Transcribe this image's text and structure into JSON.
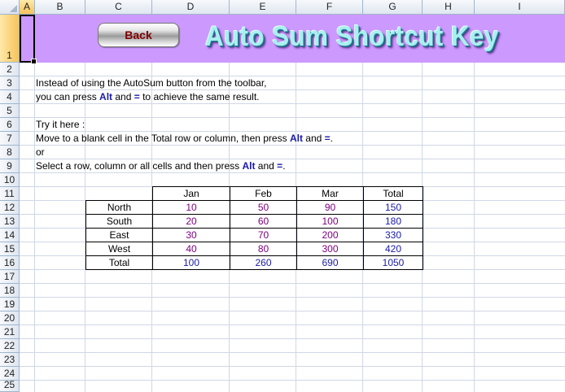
{
  "columns": [
    "A",
    "B",
    "C",
    "D",
    "E",
    "F",
    "G",
    "H",
    "I"
  ],
  "rows": [
    "1",
    "2",
    "3",
    "4",
    "5",
    "6",
    "7",
    "8",
    "9",
    "10",
    "11",
    "12",
    "13",
    "14",
    "15",
    "16",
    "17",
    "18",
    "19",
    "20",
    "21",
    "22",
    "23",
    "24",
    "25"
  ],
  "banner": {
    "back_label": "Back",
    "title": "Auto Sum Shortcut Key",
    "background": "#cc99ff"
  },
  "text": {
    "line3": "Instead of using the AutoSum button from the toolbar,",
    "line4_a": "you can press ",
    "line4_alt": "Alt",
    "line4_b": " and ",
    "line4_eq": "=",
    "line4_c": " to achieve the same result.",
    "line6": "Try it here :",
    "line7_a": "Move to a blank cell in the Total row or column, then press ",
    "line7_alt": "Alt",
    "line7_b": " and ",
    "line7_eq": "=",
    "line7_c": ".",
    "line8": "or",
    "line9_a": "Select a row, column or all cells and then press ",
    "line9_alt": "Alt",
    "line9_b": " and ",
    "line9_eq": "=",
    "line9_c": "."
  },
  "table": {
    "headers": [
      "",
      "Jan",
      "Feb",
      "Mar",
      "Total"
    ],
    "rows": [
      {
        "label": "North",
        "values": [
          "10",
          "50",
          "90",
          "150"
        ]
      },
      {
        "label": "South",
        "values": [
          "20",
          "60",
          "100",
          "180"
        ]
      },
      {
        "label": "East",
        "values": [
          "30",
          "70",
          "200",
          "330"
        ]
      },
      {
        "label": "West",
        "values": [
          "40",
          "80",
          "300",
          "420"
        ]
      },
      {
        "label": "Total",
        "values": [
          "100",
          "260",
          "690",
          "1050"
        ]
      }
    ]
  },
  "colors": {
    "keyword": "#1a1aa8",
    "value": "#800080",
    "back_text": "#800000"
  }
}
